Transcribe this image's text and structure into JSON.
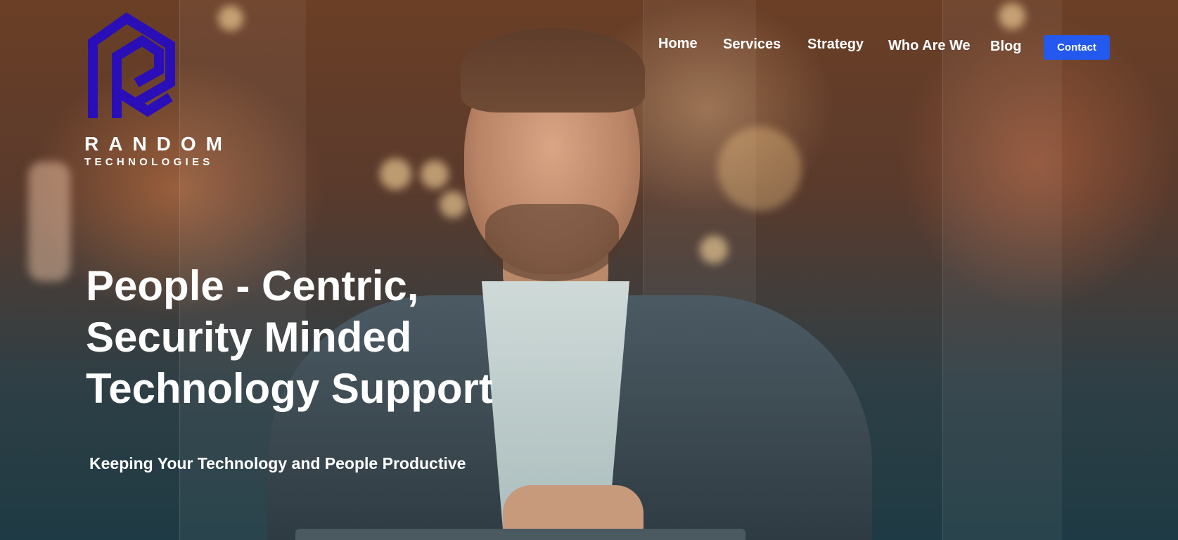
{
  "brand": {
    "name": "RANDOM",
    "subtitle": "TECHNOLOGIES",
    "logo_icon": "re-monogram-logo",
    "logo_color": "#2a0fb8"
  },
  "nav": {
    "items": [
      {
        "label": "Home"
      },
      {
        "label": "Services"
      },
      {
        "label": "Strategy"
      },
      {
        "label": "Who Are We"
      },
      {
        "label": "Blog"
      }
    ],
    "contact_label": "Contact",
    "contact_color": "#2459ef"
  },
  "hero": {
    "headline_lines": [
      "People - Centric,",
      "Security Minded",
      "Technology Support"
    ],
    "subheadline": "Keeping Your Technology and People Productive"
  }
}
